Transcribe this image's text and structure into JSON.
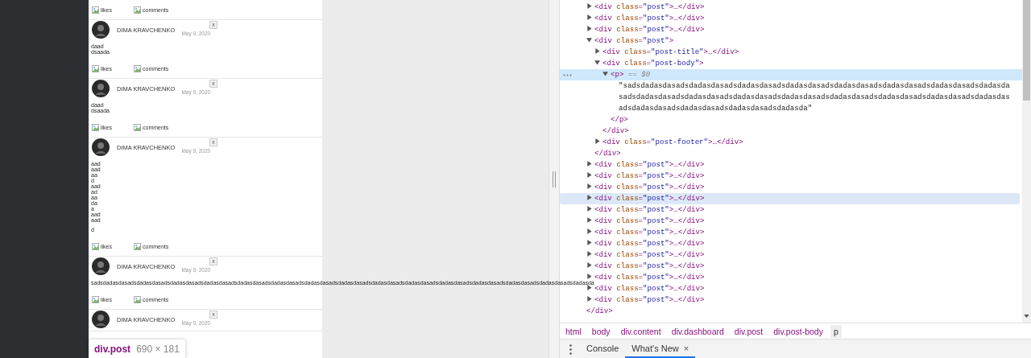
{
  "page": {
    "top_footer": {
      "likes": "likes",
      "comments": "comments"
    },
    "posts": [
      {
        "author": "DIMA KRAVCHENKO",
        "date": "May 9, 2020",
        "close": "x",
        "body": [
          [
            "daad",
            "dsaada"
          ]
        ],
        "likes": "likes",
        "comments": "comments"
      },
      {
        "author": "DIMA KRAVCHENKO",
        "date": "May 9, 2020",
        "close": "x",
        "body": [
          [
            "daad",
            "dsaada"
          ]
        ],
        "likes": "likes",
        "comments": "comments"
      },
      {
        "author": "DIMA KRAVCHENKO",
        "date": "May 9, 2020",
        "close": "x",
        "body": [
          [
            "aad",
            "aad",
            "aa",
            "d",
            "aad",
            "ad",
            "aa",
            "da",
            "a",
            "aad",
            "aad"
          ],
          [
            "d"
          ]
        ],
        "likes": "likes",
        "comments": "comments"
      },
      {
        "author": "DIMA KRAVCHENKO",
        "date": "May 9, 2020",
        "close": "x",
        "body": [
          [
            "sadsdadasdasadsdadasdasadsdadasdasadsdadasdasadsdadasdasadsdadasdasadsdadasdasadsdadasdasadsdadasdasadsdadasdasadsdadasdasadsdadasdasadsdadasdasadsdadasdasadsdadasda"
          ]
        ],
        "likes": "likes",
        "comments": "comments"
      },
      {
        "author": "DIMA KRAVCHENKO",
        "date": "May 9, 2020",
        "close": "x"
      }
    ],
    "inspect_tooltip": {
      "selector": "div.post",
      "size": "690 × 181"
    }
  },
  "elements_tree": {
    "close": [
      {
        "kind": "tag",
        "text": "</div>"
      }
    ],
    "children": [
      {
        "open": [
          {
            "kind": "tag",
            "text": "<div"
          },
          {
            "kind": "attr",
            "text": " class"
          },
          {
            "kind": "tag",
            "text": "="
          },
          {
            "kind": "value",
            "text": "\"post\""
          },
          {
            "kind": "tag",
            "text": ">…</div>"
          }
        ],
        "expanded": false,
        "selected": false,
        "hovered": false
      },
      {
        "open": [
          {
            "kind": "tag",
            "text": "<div"
          },
          {
            "kind": "attr",
            "text": " class"
          },
          {
            "kind": "tag",
            "text": "="
          },
          {
            "kind": "value",
            "text": "\"post\""
          },
          {
            "kind": "tag",
            "text": ">…</div>"
          }
        ],
        "expanded": false,
        "selected": false,
        "hovered": false
      },
      {
        "open": [
          {
            "kind": "tag",
            "text": "<div"
          },
          {
            "kind": "attr",
            "text": " class"
          },
          {
            "kind": "tag",
            "text": "="
          },
          {
            "kind": "value",
            "text": "\"post\""
          },
          {
            "kind": "tag",
            "text": ">…</div>"
          }
        ],
        "expanded": false,
        "selected": false,
        "hovered": false
      },
      {
        "open": [
          {
            "kind": "tag",
            "text": "<div"
          },
          {
            "kind": "attr",
            "text": " class"
          },
          {
            "kind": "tag",
            "text": "="
          },
          {
            "kind": "value",
            "text": "\"post\""
          },
          {
            "kind": "tag",
            "text": ">"
          }
        ],
        "expanded": true,
        "selected": false,
        "hovered": false,
        "close": [
          {
            "kind": "tag",
            "text": "</div>"
          }
        ],
        "children": [
          {
            "open": [
              {
                "kind": "tag",
                "text": "<div"
              },
              {
                "kind": "attr",
                "text": " class"
              },
              {
                "kind": "tag",
                "text": "="
              },
              {
                "kind": "value",
                "text": "\"post-title\""
              },
              {
                "kind": "tag",
                "text": ">…</div>"
              }
            ],
            "expanded": false,
            "selected": false,
            "hovered": false
          },
          {
            "open": [
              {
                "kind": "tag",
                "text": "<div"
              },
              {
                "kind": "attr",
                "text": " class"
              },
              {
                "kind": "tag",
                "text": "="
              },
              {
                "kind": "value",
                "text": "\"post-body\""
              },
              {
                "kind": "tag",
                "text": ">"
              }
            ],
            "expanded": true,
            "selected": false,
            "hovered": false,
            "close": [
              {
                "kind": "tag",
                "text": "</div>"
              }
            ],
            "children": [
              {
                "open": [
                  {
                    "kind": "tag",
                    "text": "<p>"
                  },
                  {
                    "kind": "ref",
                    "text": " == $0"
                  }
                ],
                "expanded": true,
                "selected": true,
                "hovered": false,
                "close": [
                  {
                    "kind": "tag",
                    "text": "</p>"
                  }
                ],
                "children": [
                  {
                    "kind": "text",
                    "text": "\"sadsdadasdasadsdadasdasadsdadasdasadsdadasdasadsdadasdasadsdadasdasadsdadasdasadsdadasdasadsdadasdasadsdadasdasadsdadasdasadsdadasdasadsdadasdasadsdadasdasadsdadasdasadsdadasdasadsdadasdasadsdadasdasadsdadasdasadsdadasda\""
                  }
                ]
              }
            ]
          },
          {
            "open": [
              {
                "kind": "tag",
                "text": "<div"
              },
              {
                "kind": "attr",
                "text": " class"
              },
              {
                "kind": "tag",
                "text": "="
              },
              {
                "kind": "value",
                "text": "\"post-footer\""
              },
              {
                "kind": "tag",
                "text": ">…</div>"
              }
            ],
            "expanded": false,
            "selected": false,
            "hovered": false
          }
        ]
      },
      {
        "open": [
          {
            "kind": "tag",
            "text": "<div"
          },
          {
            "kind": "attr",
            "text": " class"
          },
          {
            "kind": "tag",
            "text": "="
          },
          {
            "kind": "value",
            "text": "\"post\""
          },
          {
            "kind": "tag",
            "text": ">…</div>"
          }
        ],
        "expanded": false,
        "selected": false,
        "hovered": false
      },
      {
        "open": [
          {
            "kind": "tag",
            "text": "<div"
          },
          {
            "kind": "attr",
            "text": " class"
          },
          {
            "kind": "tag",
            "text": "="
          },
          {
            "kind": "value",
            "text": "\"post\""
          },
          {
            "kind": "tag",
            "text": ">…</div>"
          }
        ],
        "expanded": false,
        "selected": false,
        "hovered": false
      },
      {
        "open": [
          {
            "kind": "tag",
            "text": "<div"
          },
          {
            "kind": "attr",
            "text": " class"
          },
          {
            "kind": "tag",
            "text": "="
          },
          {
            "kind": "value",
            "text": "\"post\""
          },
          {
            "kind": "tag",
            "text": ">…</div>"
          }
        ],
        "expanded": false,
        "selected": false,
        "hovered": false
      },
      {
        "open": [
          {
            "kind": "tag",
            "text": "<div"
          },
          {
            "kind": "attr",
            "text": " class"
          },
          {
            "kind": "tag",
            "text": "="
          },
          {
            "kind": "value",
            "text": "\"post\""
          },
          {
            "kind": "tag",
            "text": ">…</div>"
          }
        ],
        "expanded": false,
        "selected": false,
        "hovered": true
      },
      {
        "open": [
          {
            "kind": "tag",
            "text": "<div"
          },
          {
            "kind": "attr",
            "text": " class"
          },
          {
            "kind": "tag",
            "text": "="
          },
          {
            "kind": "value",
            "text": "\"post\""
          },
          {
            "kind": "tag",
            "text": ">…</div>"
          }
        ],
        "expanded": false,
        "selected": false,
        "hovered": false
      },
      {
        "open": [
          {
            "kind": "tag",
            "text": "<div"
          },
          {
            "kind": "attr",
            "text": " class"
          },
          {
            "kind": "tag",
            "text": "="
          },
          {
            "kind": "value",
            "text": "\"post\""
          },
          {
            "kind": "tag",
            "text": ">…</div>"
          }
        ],
        "expanded": false,
        "selected": false,
        "hovered": false
      },
      {
        "open": [
          {
            "kind": "tag",
            "text": "<div"
          },
          {
            "kind": "attr",
            "text": " class"
          },
          {
            "kind": "tag",
            "text": "="
          },
          {
            "kind": "value",
            "text": "\"post\""
          },
          {
            "kind": "tag",
            "text": ">…</div>"
          }
        ],
        "expanded": false,
        "selected": false,
        "hovered": false
      },
      {
        "open": [
          {
            "kind": "tag",
            "text": "<div"
          },
          {
            "kind": "attr",
            "text": " class"
          },
          {
            "kind": "tag",
            "text": "="
          },
          {
            "kind": "value",
            "text": "\"post\""
          },
          {
            "kind": "tag",
            "text": ">…</div>"
          }
        ],
        "expanded": false,
        "selected": false,
        "hovered": false
      },
      {
        "open": [
          {
            "kind": "tag",
            "text": "<div"
          },
          {
            "kind": "attr",
            "text": " class"
          },
          {
            "kind": "tag",
            "text": "="
          },
          {
            "kind": "value",
            "text": "\"post\""
          },
          {
            "kind": "tag",
            "text": ">…</div>"
          }
        ],
        "expanded": false,
        "selected": false,
        "hovered": false
      },
      {
        "open": [
          {
            "kind": "tag",
            "text": "<div"
          },
          {
            "kind": "attr",
            "text": " class"
          },
          {
            "kind": "tag",
            "text": "="
          },
          {
            "kind": "value",
            "text": "\"post\""
          },
          {
            "kind": "tag",
            "text": ">…</div>"
          }
        ],
        "expanded": false,
        "selected": false,
        "hovered": false
      },
      {
        "open": [
          {
            "kind": "tag",
            "text": "<div"
          },
          {
            "kind": "attr",
            "text": " class"
          },
          {
            "kind": "tag",
            "text": "="
          },
          {
            "kind": "value",
            "text": "\"post\""
          },
          {
            "kind": "tag",
            "text": ">…</div>"
          }
        ],
        "expanded": false,
        "selected": false,
        "hovered": false
      },
      {
        "open": [
          {
            "kind": "tag",
            "text": "<div"
          },
          {
            "kind": "attr",
            "text": " class"
          },
          {
            "kind": "tag",
            "text": "="
          },
          {
            "kind": "value",
            "text": "\"post\""
          },
          {
            "kind": "tag",
            "text": ">…</div>"
          }
        ],
        "expanded": false,
        "selected": false,
        "hovered": false
      },
      {
        "open": [
          {
            "kind": "tag",
            "text": "<div"
          },
          {
            "kind": "attr",
            "text": " class"
          },
          {
            "kind": "tag",
            "text": "="
          },
          {
            "kind": "value",
            "text": "\"post\""
          },
          {
            "kind": "tag",
            "text": ">…</div>"
          }
        ],
        "expanded": false,
        "selected": false,
        "hovered": false
      }
    ]
  },
  "breadcrumbs": [
    {
      "label": "html",
      "selected": false
    },
    {
      "label": "body",
      "selected": false
    },
    {
      "label": "div.content",
      "selected": false
    },
    {
      "label": "div.dashboard",
      "selected": false
    },
    {
      "label": "div.post",
      "selected": false
    },
    {
      "label": "div.post-body",
      "selected": false
    },
    {
      "label": "p",
      "selected": true
    }
  ],
  "drawer_tabs": [
    {
      "label": "Console",
      "selected": false
    },
    {
      "label": "What's New",
      "selected": true,
      "close": "×"
    }
  ]
}
